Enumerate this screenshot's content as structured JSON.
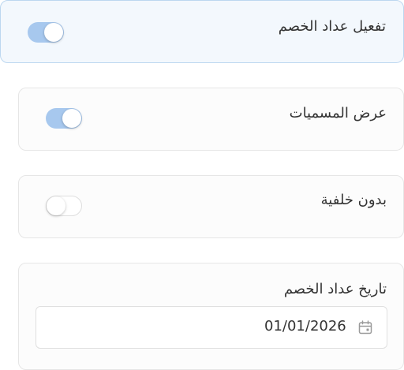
{
  "settings": {
    "enable_countdown": {
      "label": "تفعيل عداد الخصم",
      "enabled": true
    },
    "show_labels": {
      "label": "عرض المسميات",
      "enabled": true
    },
    "no_background": {
      "label": "بدون خلفية",
      "enabled": false
    },
    "countdown_date": {
      "label": "تاريخ عداد الخصم",
      "value": "01/01/2026",
      "icon": "calendar-icon"
    }
  },
  "colors": {
    "accent": "#a7c8ee",
    "active_card_bg": "#f3f8fd",
    "active_card_border": "#bcd7f0"
  }
}
